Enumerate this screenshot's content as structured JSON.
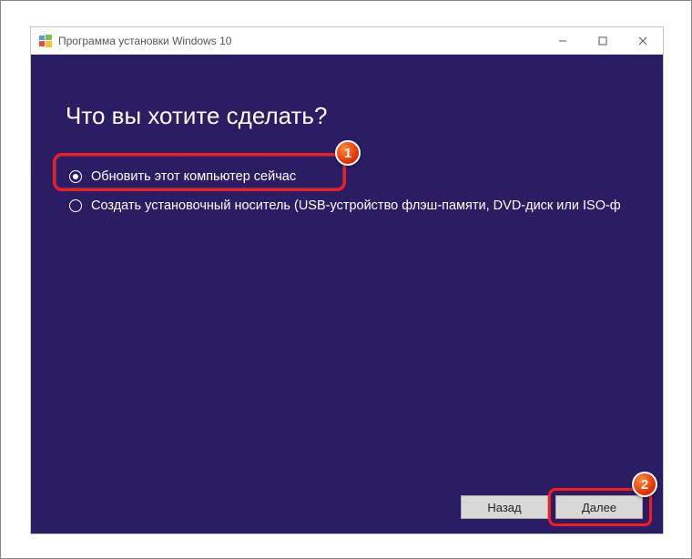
{
  "window": {
    "title": "Программа установки Windows 10"
  },
  "heading": "Что вы хотите сделать?",
  "options": [
    {
      "label": "Обновить этот компьютер сейчас",
      "selected": true
    },
    {
      "label": "Создать установочный носитель (USB-устройство флэш-памяти, DVD-диск или ISO-ф",
      "selected": false
    }
  ],
  "buttons": {
    "back": "Назад",
    "next": "Далее"
  },
  "annotations": {
    "badge1": "1",
    "badge2": "2"
  }
}
